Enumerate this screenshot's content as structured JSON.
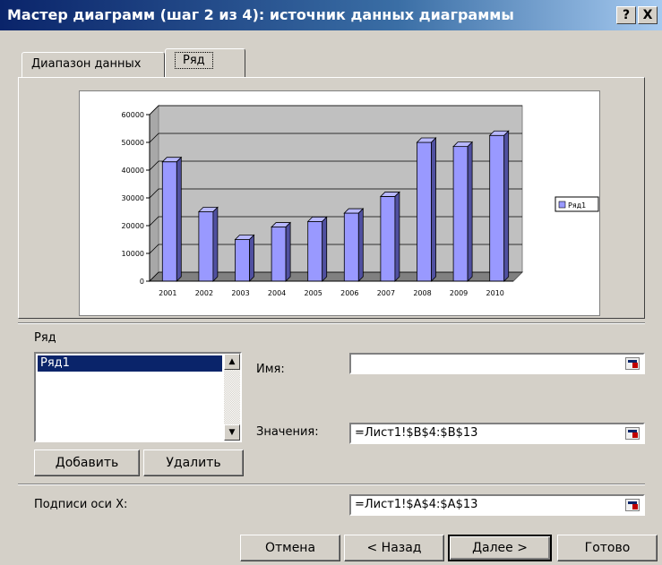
{
  "window": {
    "title": "Мастер диаграмм (шаг 2 из 4): источник данных диаграммы",
    "help_button": "?",
    "close_button": "X"
  },
  "tabs": [
    {
      "label": "Диапазон данных",
      "active": false
    },
    {
      "label": "Ряд",
      "active": true
    }
  ],
  "chart_data": {
    "type": "bar",
    "style": "3d-column",
    "categories": [
      "2001",
      "2002",
      "2003",
      "2004",
      "2005",
      "2006",
      "2007",
      "2008",
      "2009",
      "2010"
    ],
    "series": [
      {
        "name": "Ряд1",
        "values": [
          43000,
          25000,
          15000,
          19500,
          21500,
          24500,
          30500,
          50000,
          48500,
          52500
        ],
        "color": "#9999ff"
      }
    ],
    "yticks": [
      "0",
      "10000",
      "20000",
      "30000",
      "40000",
      "50000",
      "60000"
    ],
    "ylim": [
      0,
      60000
    ],
    "grid": true,
    "wall_color": "#c0c0c0",
    "floor_color": "#808080",
    "legend_position": "right"
  },
  "series_section": {
    "label": "Ряд",
    "items": [
      "Ряд1"
    ],
    "selected": "Ряд1",
    "add_button": "Добавить",
    "remove_button": "Удалить"
  },
  "name_field": {
    "label": "Имя:",
    "value": ""
  },
  "values_field": {
    "label": "Значения:",
    "value": "=Лист1!$B$4:$B$13"
  },
  "xlabels_field": {
    "label": "Подписи оси X:",
    "value": "=Лист1!$A$4:$A$13"
  },
  "footer": {
    "cancel": "Отмена",
    "back": "< Назад",
    "next": "Далее >",
    "finish": "Готово"
  }
}
